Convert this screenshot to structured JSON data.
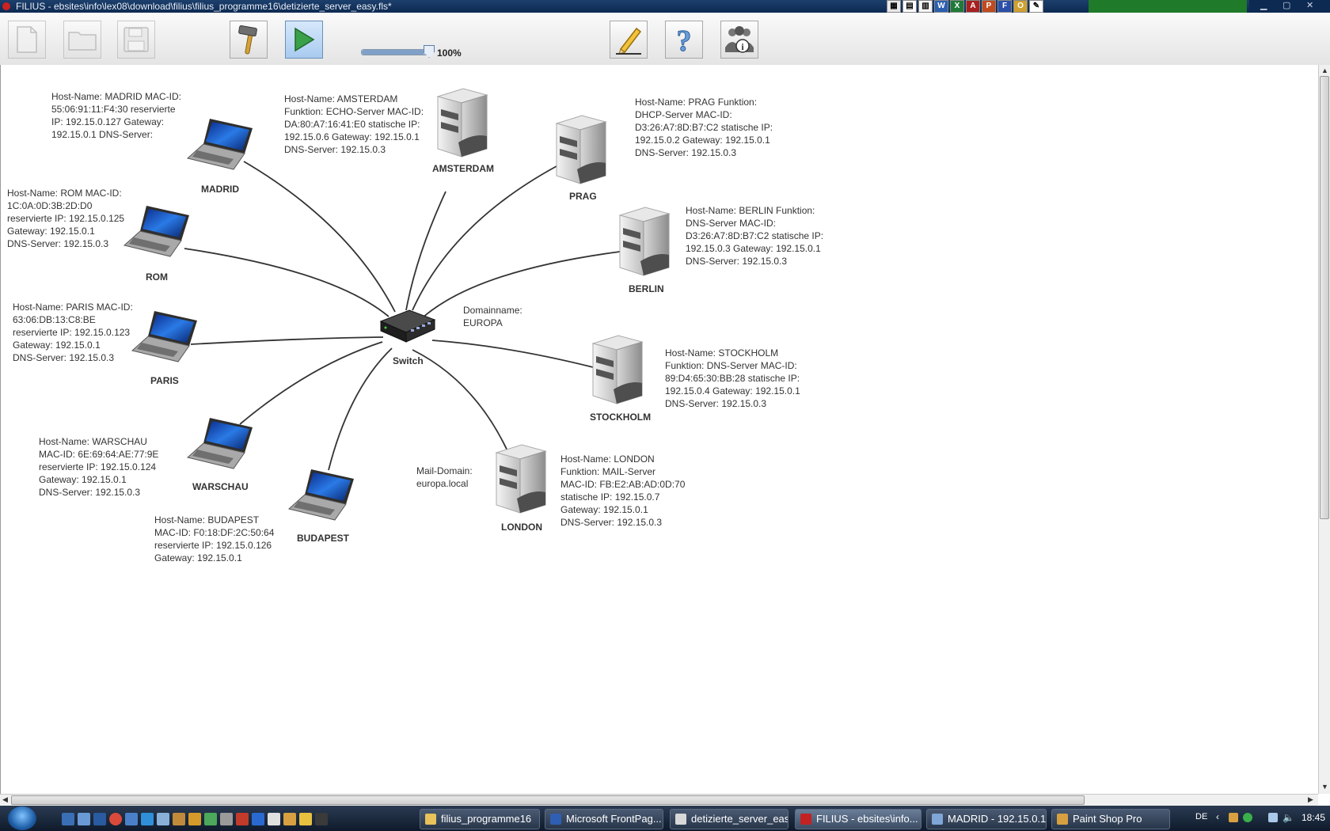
{
  "window": {
    "title": "FILIUS - ebsites\\info\\lex08\\download\\filius\\filius_programme16\\detizierte_server_easy.fls*"
  },
  "toolbar": {
    "zoom_label": "100%",
    "zoom_value": 100
  },
  "network": {
    "switch": {
      "label": "Switch",
      "domain_info": [
        "Domainname:",
        "EUROPA"
      ]
    },
    "nodes": [
      {
        "id": "madrid",
        "label": "MADRID",
        "kind": "laptop",
        "info": [
          "Host-Name: MADRID MAC-ID:",
          "55:06:91:11:F4:30 reservierte",
          "IP: 192.15.0.127 Gateway:",
          "192.15.0.1 DNS-Server:"
        ]
      },
      {
        "id": "rom",
        "label": "ROM",
        "kind": "laptop",
        "info": [
          "Host-Name: ROM MAC-ID:",
          "1C:0A:0D:3B:2D:D0",
          "reservierte IP: 192.15.0.125",
          "Gateway: 192.15.0.1",
          "DNS-Server: 192.15.0.3"
        ]
      },
      {
        "id": "paris",
        "label": "PARIS",
        "kind": "laptop",
        "info": [
          "Host-Name: PARIS MAC-ID:",
          "63:06:DB:13:C8:BE",
          "reservierte IP: 192.15.0.123",
          "Gateway: 192.15.0.1",
          "DNS-Server: 192.15.0.3"
        ]
      },
      {
        "id": "warschau",
        "label": "WARSCHAU",
        "kind": "laptop",
        "info": [
          "Host-Name: WARSCHAU",
          "MAC-ID: 6E:69:64:AE:77:9E",
          "reservierte IP: 192.15.0.124",
          "Gateway: 192.15.0.1",
          "DNS-Server: 192.15.0.3"
        ]
      },
      {
        "id": "budapest",
        "label": "BUDAPEST",
        "kind": "laptop",
        "info": [
          "Host-Name: BUDAPEST",
          "MAC-ID: F0:18:DF:2C:50:64",
          "reservierte IP: 192.15.0.126",
          "Gateway: 192.15.0.1"
        ]
      },
      {
        "id": "amsterdam",
        "label": "AMSTERDAM",
        "kind": "server",
        "info": [
          "Host-Name: AMSTERDAM",
          "Funktion: ECHO-Server MAC-ID:",
          "DA:80:A7:16:41:E0 statische IP:",
          "192.15.0.6 Gateway: 192.15.0.1",
          "DNS-Server: 192.15.0.3"
        ]
      },
      {
        "id": "prag",
        "label": "PRAG",
        "kind": "server",
        "info": [
          "Host-Name: PRAG Funktion:",
          "DHCP-Server MAC-ID:",
          "D3:26:A7:8D:B7:C2 statische IP:",
          "192.15.0.2 Gateway: 192.15.0.1",
          "DNS-Server: 192.15.0.3"
        ]
      },
      {
        "id": "berlin",
        "label": "BERLIN",
        "kind": "server",
        "info": [
          "Host-Name: BERLIN Funktion:",
          "DNS-Server MAC-ID:",
          "D3:26:A7:8D:B7:C2 statische IP:",
          "192.15.0.3 Gateway: 192.15.0.1",
          "DNS-Server: 192.15.0.3"
        ]
      },
      {
        "id": "stockholm",
        "label": "STOCKHOLM",
        "kind": "server",
        "info": [
          "Host-Name: STOCKHOLM",
          "Funktion: DNS-Server MAC-ID:",
          "89:D4:65:30:BB:28 statische IP:",
          "192.15.0.4 Gateway: 192.15.0.1",
          "DNS-Server: 192.15.0.3"
        ]
      },
      {
        "id": "london",
        "label": "LONDON",
        "kind": "server",
        "info": [
          "Host-Name: LONDON",
          "Funktion: MAIL-Server",
          "MAC-ID: FB:E2:AB:AD:0D:70",
          "statische IP: 192.15.0.7",
          "Gateway: 192.15.0.1",
          "DNS-Server: 192.15.0.3"
        ],
        "extra_info": [
          "Mail-Domain:",
          "europa.local"
        ]
      }
    ]
  },
  "taskbar": {
    "tasks": [
      {
        "label": "filius_programme16",
        "icon_color": "#e8c25a"
      },
      {
        "label": "Microsoft FrontPag...",
        "icon_color": "#2f5fb3"
      },
      {
        "label": "detizierte_server_eas...",
        "icon_color": "#d8d8d8"
      },
      {
        "label": "FILIUS - ebsites\\info...",
        "icon_color": "#c22222"
      },
      {
        "label": "MADRID - 192.15.0.1...",
        "icon_color": "#7fa6d6"
      },
      {
        "label": "Paint Shop Pro",
        "icon_color": "#d6a040"
      }
    ],
    "language": "DE",
    "clock": "18:45"
  }
}
